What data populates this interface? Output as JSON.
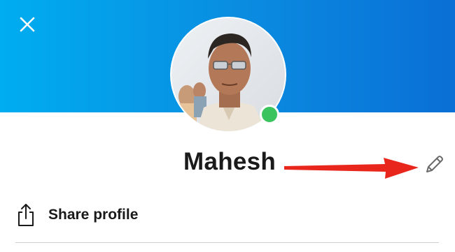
{
  "profile": {
    "display_name": "Mahesh",
    "status": "online",
    "header_color": "#0a8be0",
    "status_color": "#3bc45e"
  },
  "actions": {
    "share_label": "Share profile"
  },
  "icons": {
    "close": "close-icon",
    "edit": "pencil-icon",
    "share": "share-icon"
  },
  "annotation": {
    "arrow_color": "#e8261c"
  }
}
